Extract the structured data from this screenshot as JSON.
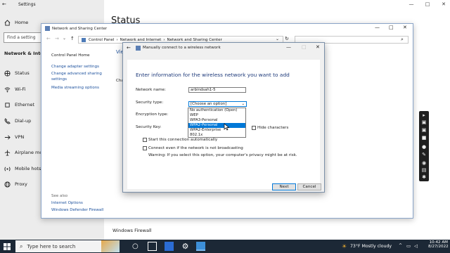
{
  "settings": {
    "title": "Settings",
    "home": "Home",
    "find_placeholder": "Find a setting",
    "section": "Network & Internet",
    "page_title": "Status",
    "nav": [
      "Status",
      "Wi-Fi",
      "Ethernet",
      "Dial-up",
      "VPN",
      "Airplane mode",
      "Mobile hotspot",
      "Proxy"
    ],
    "bottom_link": "Windows Firewall"
  },
  "cp": {
    "title": "Network and Sharing Center",
    "breadcrumb": [
      "Control Panel",
      "Network and Internet",
      "Network and Sharing Center"
    ],
    "left_links": [
      "Control Panel Home",
      "Change adapter settings",
      "Change advanced sharing settings",
      "Media streaming options"
    ],
    "see_also": "See also",
    "see_also_links": [
      "Internet Options",
      "Windows Defender Firewall"
    ],
    "partial_view": "Vie",
    "partial_cha": "Cha"
  },
  "dialog": {
    "title": "Manually connect to a wireless network",
    "heading": "Enter information for the wireless network you want to add",
    "network_name_label": "Network name:",
    "network_name_value": "arbindsah1-5",
    "security_type_label": "Security type:",
    "security_type_value": "[Choose an option]",
    "encryption_type_label": "Encryption type:",
    "security_key_label": "Security Key:",
    "hide_characters": "Hide characters",
    "security_options": [
      "No authentication (Open)",
      "WEP",
      "WPA3-Personal",
      "WPA2-Personal",
      "WPA2-Enterprise",
      "802.1x"
    ],
    "selected_option_index": 3,
    "start_auto": "Start this connection automatically",
    "connect_even": "Connect even if the network is not broadcasting",
    "warning": "Warning: If you select this option, your computer's privacy might be at risk.",
    "next": "Next",
    "cancel": "Cancel"
  },
  "taskbar": {
    "search_placeholder": "Type here to search",
    "weather": "73°F  Mostly cloudy",
    "time": "10:42 AM",
    "date": "8/27/2022"
  },
  "colors": {
    "accent": "#0067c0",
    "selected": "#0078d7",
    "taskbar": "#1c2836",
    "link": "#1a4f9c"
  }
}
